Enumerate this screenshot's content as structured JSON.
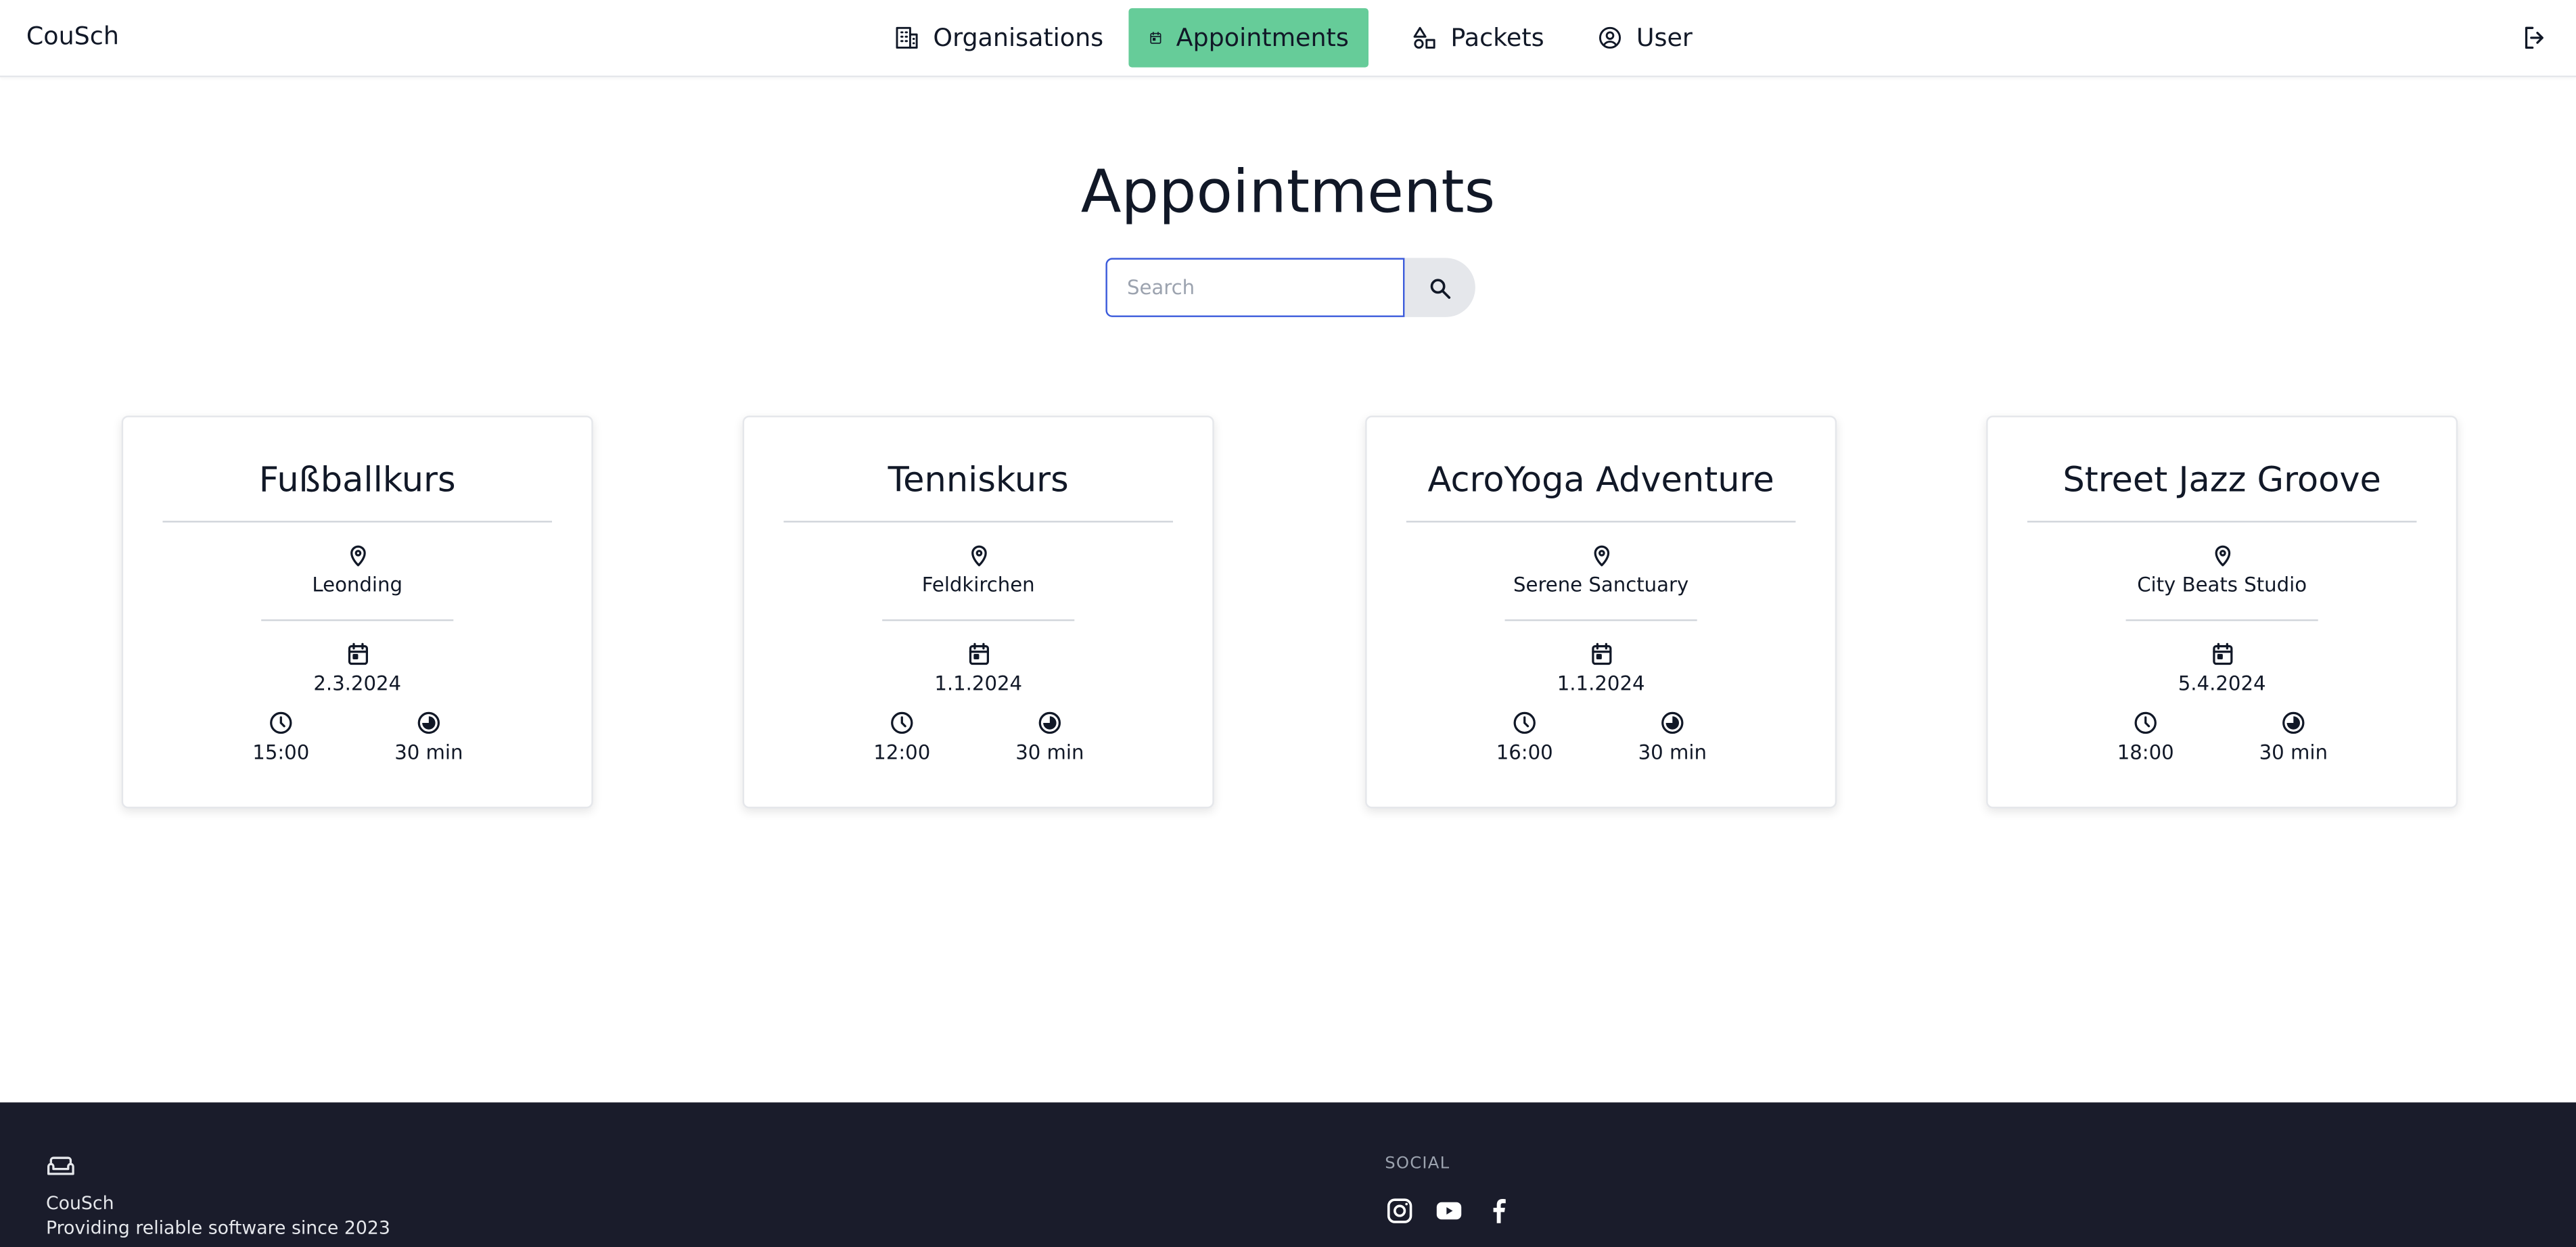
{
  "header": {
    "brand": "CouSch",
    "nav": [
      {
        "label": "Organisations",
        "icon": "building-icon",
        "active": false
      },
      {
        "label": "Appointments",
        "icon": "calendar-icon",
        "active": true
      },
      {
        "label": "Packets",
        "icon": "shapes-icon",
        "active": false
      },
      {
        "label": "User",
        "icon": "user-circle-icon",
        "active": false
      }
    ],
    "logout_icon": "logout-icon",
    "active_color": "#66cc99"
  },
  "page": {
    "title": "Appointments"
  },
  "search": {
    "placeholder": "Search",
    "value": "",
    "focus_color": "#3b5bdb"
  },
  "appointments": [
    {
      "title": "Fußballkurs",
      "location": "Leonding",
      "date": "2.3.2024",
      "time": "15:00",
      "duration": "30 min"
    },
    {
      "title": "Tenniskurs",
      "location": "Feldkirchen",
      "date": "1.1.2024",
      "time": "12:00",
      "duration": "30 min"
    },
    {
      "title": "AcroYoga Adventure",
      "location": "Serene Sanctuary",
      "date": "1.1.2024",
      "time": "16:00",
      "duration": "30 min"
    },
    {
      "title": "Street Jazz Groove",
      "location": "City Beats Studio",
      "date": "5.4.2024",
      "time": "18:00",
      "duration": "30 min"
    }
  ],
  "footer": {
    "brand": "CouSch",
    "tagline": "Providing reliable software since 2023",
    "social_heading": "SOCIAL",
    "social": [
      "instagram-icon",
      "youtube-icon",
      "facebook-icon"
    ],
    "background": "#1a1c2b"
  }
}
